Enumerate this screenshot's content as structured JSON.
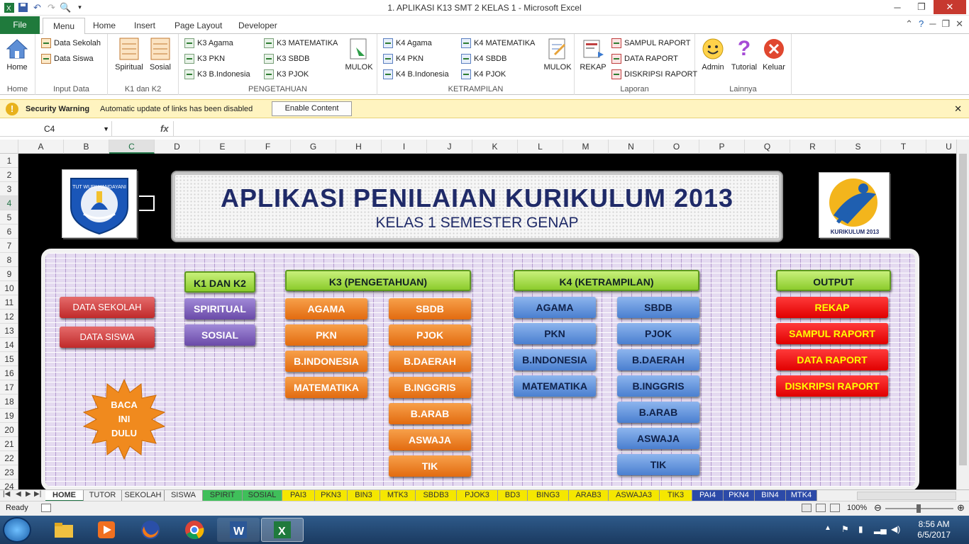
{
  "window": {
    "title": "1. APLIKASI K13 SMT 2 KELAS 1  -  Microsoft Excel"
  },
  "tabs": [
    "File",
    "Menu",
    "Home",
    "Insert",
    "Page Layout",
    "Developer"
  ],
  "ribbon": {
    "home_label": "Home",
    "home_group": "Home",
    "input_data": {
      "label": "Input Data",
      "items": [
        "Data Sekolah",
        "Data Siswa"
      ]
    },
    "k1k2": {
      "label": "K1 dan K2",
      "items": [
        "Spiritual",
        "Sosial"
      ]
    },
    "pengetahuan": {
      "label": "PENGETAHUAN",
      "col1": [
        "K3 Agama",
        "K3 PKN",
        "K3 B.Indonesia"
      ],
      "col2": [
        "K3 MATEMATIKA",
        "K3 SBDB",
        "K3 PJOK"
      ],
      "mulok": "MULOK"
    },
    "ketrampilan": {
      "label": "KETRAMPILAN",
      "col1": [
        "K4 Agama",
        "K4 PKN",
        "K4 B.Indonesia"
      ],
      "col2": [
        "K4 MATEMATIKA",
        "K4 SBDB",
        "K4 PJOK"
      ],
      "mulok": "MULOK"
    },
    "laporan": {
      "label": "Laporan",
      "rekap": "REKAP",
      "items": [
        "SAMPUL RAPORT",
        "DATA RAPORT",
        "DISKRIPSI RAPORT"
      ]
    },
    "lainnya": {
      "label": "Lainnya",
      "items": [
        "Admin",
        "Tutorial",
        "Keluar"
      ]
    }
  },
  "security": {
    "title": "Security Warning",
    "message": "Automatic update of links has been disabled",
    "button": "Enable Content"
  },
  "formula": {
    "namebox": "C4",
    "fx": "fx",
    "value": ""
  },
  "columns": [
    "A",
    "B",
    "C",
    "D",
    "E",
    "F",
    "G",
    "H",
    "I",
    "J",
    "K",
    "L",
    "M",
    "N",
    "O",
    "P",
    "Q",
    "R",
    "S",
    "T",
    "U"
  ],
  "rows": [
    "1",
    "2",
    "3",
    "4",
    "5",
    "6",
    "7",
    "8",
    "9",
    "10",
    "11",
    "12",
    "13",
    "14",
    "15",
    "16",
    "17",
    "18",
    "19",
    "20",
    "21",
    "22",
    "23",
    "24"
  ],
  "header": {
    "title": "APLIKASI PENILAIAN KURIKULUM 2013",
    "subtitle": "KELAS 1 SEMESTER GENAP",
    "logo_left_text": "TUT WURI HANDAYANI",
    "logo_right_text": "KURIKULUM 2013"
  },
  "menu": {
    "data_sekolah": "DATA SEKOLAH",
    "data_siswa": "DATA SISWA",
    "baca": [
      "BACA",
      "INI",
      "DULU"
    ],
    "k1k2_header": "K1 DAN K2",
    "k1k2": [
      "SPIRITUAL",
      "SOSIAL"
    ],
    "k3_header": "K3 (PENGETAHUAN)",
    "k3_left": [
      "AGAMA",
      "PKN",
      "B.INDONESIA",
      "MATEMATIKA"
    ],
    "k3_right": [
      "SBDB",
      "PJOK",
      "B.DAERAH",
      "B.INGGRIS",
      "B.ARAB",
      "ASWAJA",
      "TIK"
    ],
    "k4_header": "K4 (KETRAMPILAN)",
    "k4_left": [
      "AGAMA",
      "PKN",
      "B.INDONESIA",
      "MATEMATIKA"
    ],
    "k4_right": [
      "SBDB",
      "PJOK",
      "B.DAERAH",
      "B.INGGRIS",
      "B.ARAB",
      "ASWAJA",
      "TIK"
    ],
    "output_header": "OUTPUT",
    "output": [
      "REKAP",
      "SAMPUL RAPORT",
      "DATA RAPORT",
      "DISKRIPSI RAPORT"
    ]
  },
  "sheet_tabs": [
    "HOME",
    "TUTOR",
    "SEKOLAH",
    "SISWA",
    "SPIRIT",
    "SOSIAL",
    "PAI3",
    "PKN3",
    "BIN3",
    "MTK3",
    "SBDB3",
    "PJOK3",
    "BD3",
    "BING3",
    "ARAB3",
    "ASWAJA3",
    "TIK3",
    "PAI4",
    "PKN4",
    "BIN4",
    "MTK4"
  ],
  "status": {
    "ready": "Ready",
    "zoom": "100%"
  },
  "clock": {
    "time": "8:56 AM",
    "date": "6/5/2017"
  }
}
